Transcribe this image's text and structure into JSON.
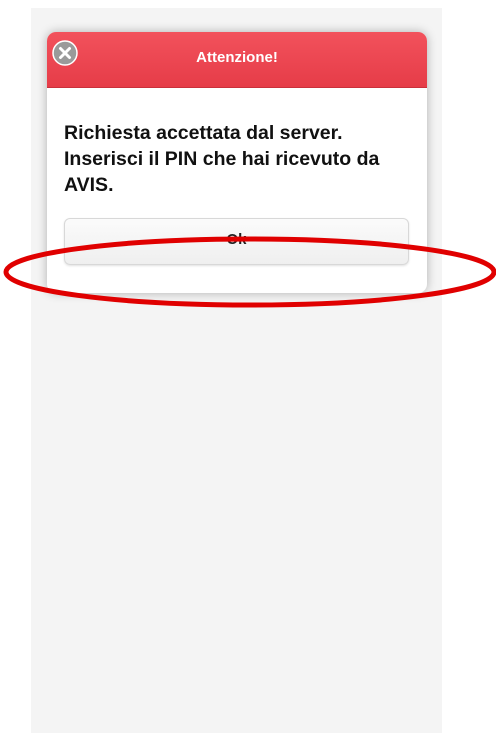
{
  "dialog": {
    "title": "Attenzione!",
    "close_icon": "close-circle-icon",
    "message": "Richiesta accettata dal server. Inserisci il PIN che hai ricevuto da AVIS.",
    "ok_label": "Ok"
  },
  "colors": {
    "header_bg": "#e9424d",
    "header_text": "#ffffff",
    "annotation_stroke": "#e00000"
  }
}
